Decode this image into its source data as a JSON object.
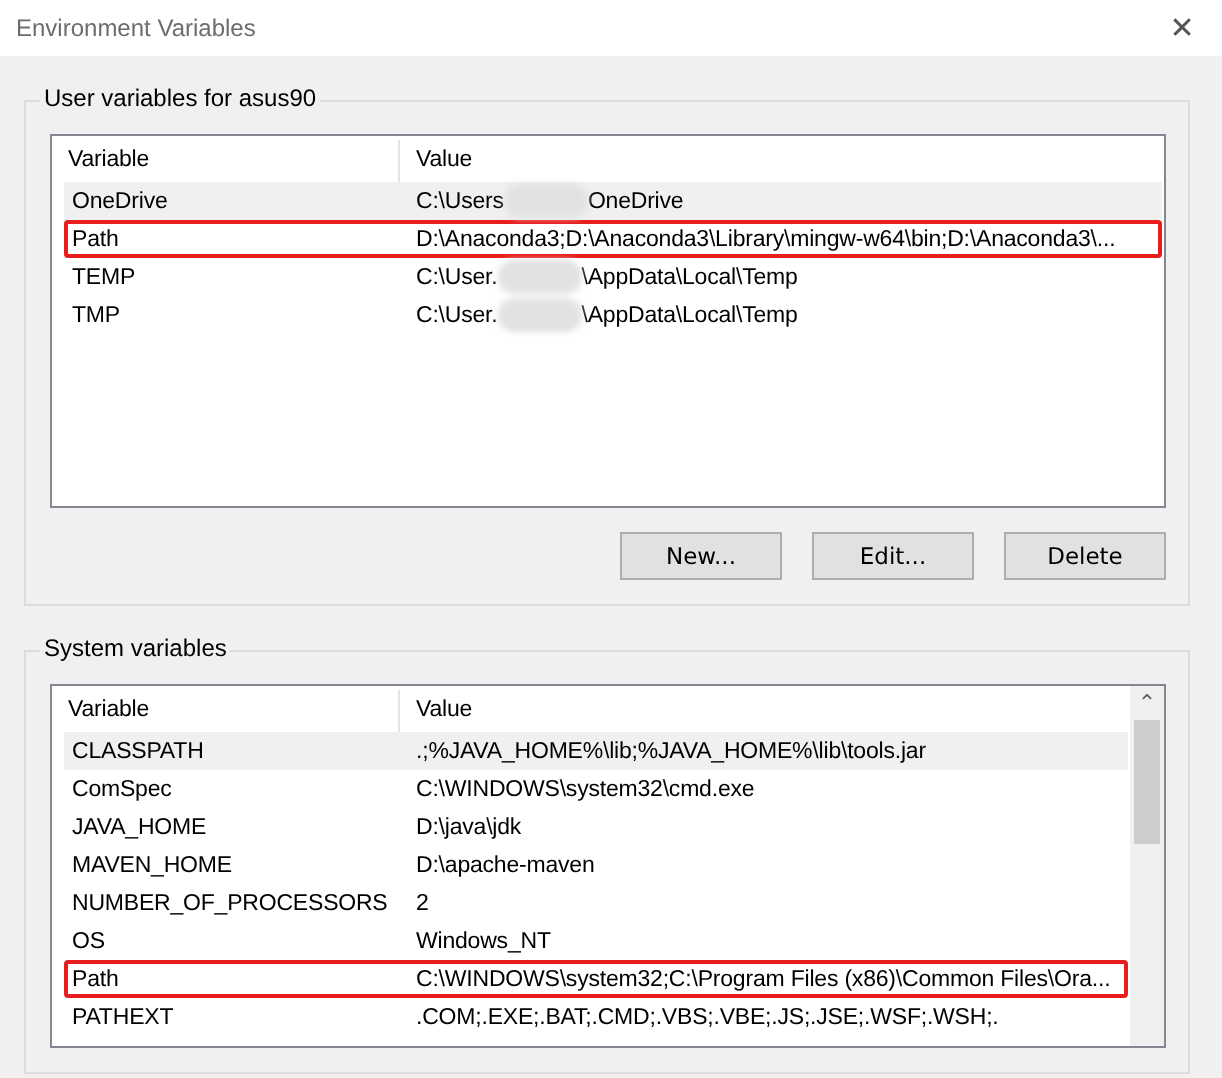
{
  "window": {
    "title": "Environment Variables",
    "close": "✕"
  },
  "user_variables": {
    "title": "User variables for asus90",
    "columns": [
      "Variable",
      "Value"
    ],
    "rows": [
      {
        "variable": "OneDrive",
        "value": "C:\\Users",
        "value_after": "OneDrive",
        "blurred": true,
        "selected": true,
        "highlighted": false
      },
      {
        "variable": "Path",
        "value": "D:\\Anaconda3;D:\\Anaconda3\\Library\\mingw-w64\\bin;D:\\Anaconda3\\...",
        "blurred": false,
        "selected": false,
        "highlighted": true
      },
      {
        "variable": "TEMP",
        "value": "C:\\User.",
        "value_after": "\\AppData\\Local\\Temp",
        "blurred": true,
        "selected": false,
        "highlighted": false
      },
      {
        "variable": "TMP",
        "value": "C:\\User.",
        "value_after": "\\AppData\\Local\\Temp",
        "blurred": true,
        "selected": false,
        "highlighted": false
      }
    ],
    "buttons": [
      "New...",
      "Edit...",
      "Delete"
    ]
  },
  "system_variables": {
    "title": "System variables",
    "columns": [
      "Variable",
      "Value"
    ],
    "scroll_up": "⌃",
    "rows": [
      {
        "variable": "CLASSPATH",
        "value": ".;%JAVA_HOME%\\lib;%JAVA_HOME%\\lib\\tools.jar",
        "blurred": false,
        "selected": true,
        "highlighted": false
      },
      {
        "variable": "ComSpec",
        "value": "C:\\WINDOWS\\system32\\cmd.exe",
        "blurred": false,
        "selected": false,
        "highlighted": false
      },
      {
        "variable": "JAVA_HOME",
        "value": "D:\\java\\jdk",
        "blurred": false,
        "selected": false,
        "highlighted": false
      },
      {
        "variable": "MAVEN_HOME",
        "value": "D:\\apache-maven",
        "blurred": false,
        "selected": false,
        "highlighted": false
      },
      {
        "variable": "NUMBER_OF_PROCESSORS",
        "value": "2",
        "blurred": false,
        "selected": false,
        "highlighted": false
      },
      {
        "variable": "OS",
        "value": "Windows_NT",
        "blurred": false,
        "selected": false,
        "highlighted": false
      },
      {
        "variable": "Path",
        "value": "C:\\WINDOWS\\system32;C:\\Program Files (x86)\\Common Files\\Ora...",
        "blurred": false,
        "selected": false,
        "highlighted": true
      },
      {
        "variable": "PATHEXT",
        "value": ".COM;.EXE;.BAT;.CMD;.VBS;.VBE;.JS;.JSE;.WSF;.WSH;.",
        "blurred": false,
        "selected": false,
        "highlighted": false
      }
    ]
  }
}
